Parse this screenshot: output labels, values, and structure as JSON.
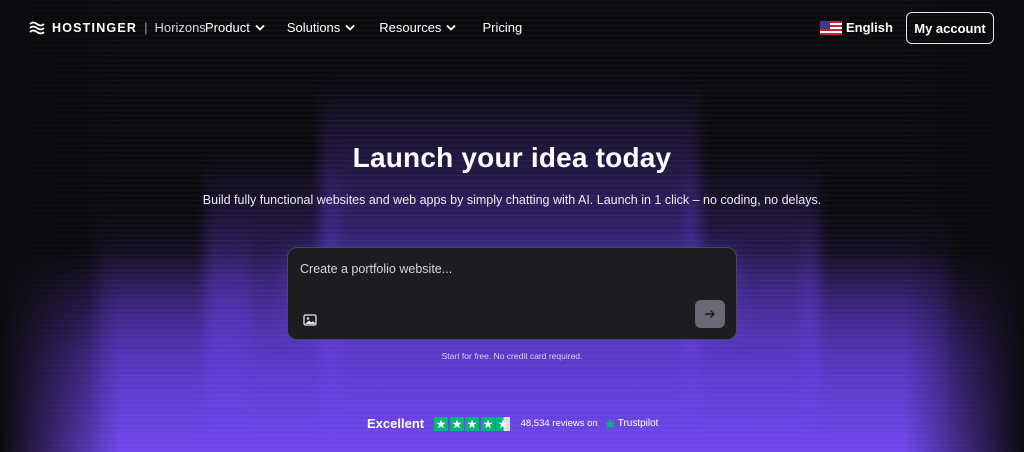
{
  "brand": {
    "name": "HOSTINGER",
    "separator": "|",
    "product": "Horizons"
  },
  "nav": {
    "items": [
      {
        "label": "Product",
        "has_dropdown": true
      },
      {
        "label": "Solutions",
        "has_dropdown": true
      },
      {
        "label": "Resources",
        "has_dropdown": true
      },
      {
        "label": "Pricing",
        "has_dropdown": false
      }
    ],
    "language": {
      "label": "English",
      "icon": "us-flag-icon"
    },
    "account_button": "My account"
  },
  "hero": {
    "title": "Launch your idea today",
    "subtitle": "Build fully functional websites and web apps by simply chatting with AI. Launch in 1 click – no coding, no delays."
  },
  "prompt": {
    "placeholder": "Create a portfolio website...",
    "value": "",
    "image_icon": "image-icon",
    "send_icon": "arrow-right-icon"
  },
  "fine_print": "Start for free. No credit card required.",
  "trust": {
    "rating_word": "Excellent",
    "stars": 4.5,
    "reviews": "48,534 reviews on",
    "provider": "Trustpilot"
  },
  "colors": {
    "background": "#0b0b0d",
    "accent_purple": "#7047eb",
    "trustpilot_green": "#00b67a",
    "send_button": "#6b6875"
  }
}
